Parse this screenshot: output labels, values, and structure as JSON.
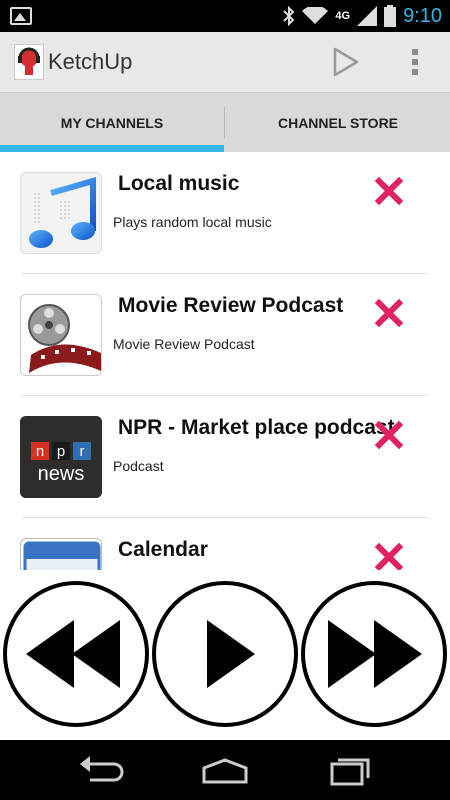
{
  "status_bar": {
    "time": "9:10",
    "network": "4G",
    "icons": [
      "gallery-icon",
      "bluetooth-icon",
      "wifi-icon",
      "signal-icon",
      "battery-icon"
    ]
  },
  "action_bar": {
    "title": "KetchUp",
    "icons": [
      "app-logo-icon",
      "play-icon",
      "overflow-menu-icon"
    ]
  },
  "tabs": [
    {
      "label": "MY CHANNELS",
      "selected": true
    },
    {
      "label": "CHANNEL STORE",
      "selected": false
    }
  ],
  "channels": [
    {
      "title": "Local music",
      "description": "Plays random local music",
      "icon": "music-note-icon"
    },
    {
      "title": "Movie Review Podcast",
      "description": "Movie Review Podcast",
      "icon": "film-reel-icon"
    },
    {
      "title": "NPR - Market place podcast",
      "description": "Podcast",
      "icon": "npr-news-icon"
    },
    {
      "title": "Calendar",
      "description": "",
      "icon": "calendar-icon"
    }
  ],
  "controls": [
    "rewind-icon",
    "play-icon",
    "fast-forward-icon"
  ],
  "nav_bar": [
    "back-icon",
    "home-icon",
    "recent-apps-icon"
  ],
  "colors": {
    "accent": "#33b5e5",
    "delete": "#e0235f",
    "action_bar": "#e8e8e8",
    "tabs": "#d9d9d9"
  }
}
